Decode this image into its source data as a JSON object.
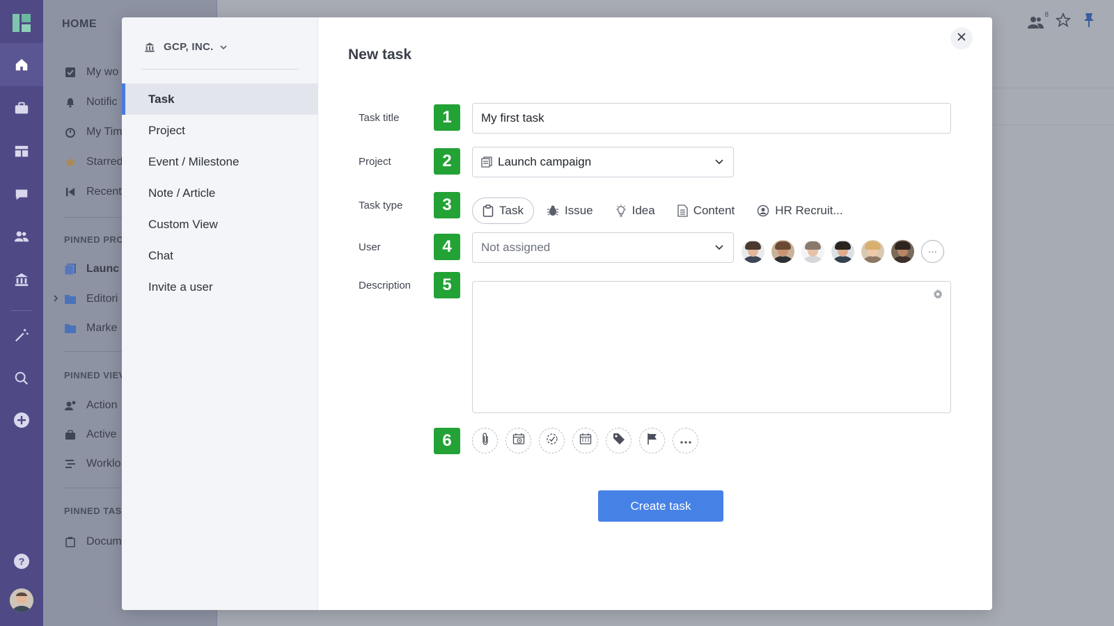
{
  "background": {
    "sidebar": {
      "heading": "HOME",
      "items": [
        {
          "label": "My wo",
          "icon": "checkbox-icon"
        },
        {
          "label": "Notific",
          "icon": "bell-icon"
        },
        {
          "label": "My Tim",
          "icon": "timer-icon"
        },
        {
          "label": "Starred",
          "icon": "star-icon"
        },
        {
          "label": "Recent",
          "icon": "recent-icon"
        }
      ],
      "pinned_projects_heading": "PINNED PRO",
      "pinned_projects": [
        {
          "label": "Launc",
          "icon": "project-icon"
        },
        {
          "label": "Editori",
          "icon": "folder-icon"
        },
        {
          "label": "Marke",
          "icon": "folder-icon"
        }
      ],
      "pinned_views_heading": "PINNED VIEV",
      "pinned_views": [
        {
          "label": "Action",
          "icon": "user-action-icon"
        },
        {
          "label": "Active",
          "icon": "briefcase-icon"
        },
        {
          "label": "Worklo",
          "icon": "workload-icon"
        }
      ],
      "pinned_tasks_heading": "PINNED TAS",
      "pinned_tasks": [
        {
          "label": "Docum",
          "icon": "task-icon"
        }
      ]
    },
    "top_badge": "8"
  },
  "modal": {
    "org": {
      "label": "GCP, INC."
    },
    "types": [
      "Task",
      "Project",
      "Event / Milestone",
      "Note / Article",
      "Custom View",
      "Chat",
      "Invite a user"
    ],
    "active_type_index": 0,
    "title": "New task",
    "fields": {
      "task_title": {
        "label": "Task title",
        "badge": "1",
        "value": "My first task"
      },
      "project": {
        "label": "Project",
        "badge": "2",
        "value": "Launch campaign"
      },
      "task_type": {
        "label": "Task type",
        "badge": "3",
        "options": [
          "Task",
          "Issue",
          "Idea",
          "Content",
          "HR Recruit..."
        ],
        "selected": "Task"
      },
      "user": {
        "label": "User",
        "badge": "4",
        "placeholder": "Not assigned"
      },
      "description": {
        "label": "Description",
        "badge": "5"
      },
      "toolbar": {
        "badge": "6"
      }
    },
    "avatar_more_label": "···",
    "create_label": "Create task",
    "colors": {
      "accent": "#4681e6",
      "badge": "#23a236",
      "active_border": "#4a7be0"
    }
  }
}
